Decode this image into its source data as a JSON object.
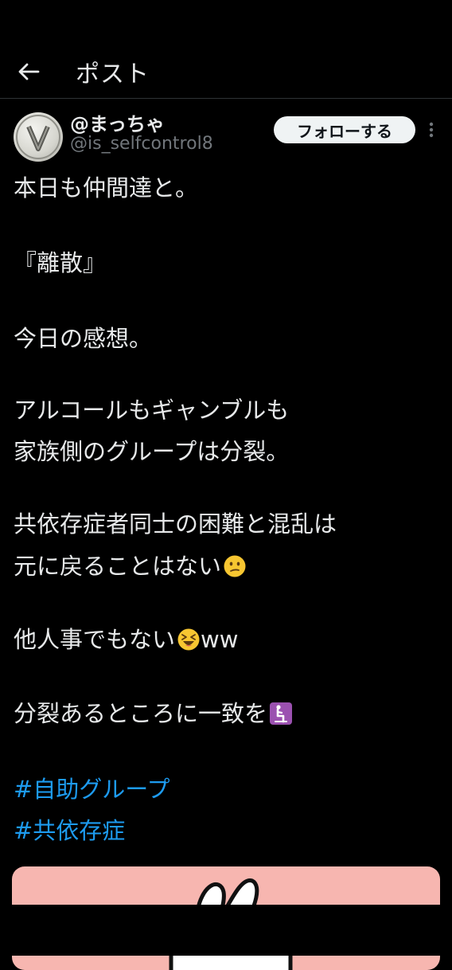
{
  "header": {
    "back_icon": "arrow-left-icon",
    "title": "ポスト"
  },
  "author": {
    "avatar_icon": "avatar-v-coin",
    "display_name": "@まっちゃ",
    "handle": "@is_selfcontrol8",
    "follow_label": "フォローする",
    "more_icon": "more-vertical-icon"
  },
  "post": {
    "lines": [
      "本日も仲間達と。",
      "『離散』",
      "今日の感想。",
      "アルコールもギャンブルも",
      "家族側のグループは分裂。",
      "共依存症者同士の困難と混乱は",
      "元に戻ることはない",
      "他人事でもない",
      "ww",
      "分裂あるところに一致を"
    ],
    "emojis": {
      "confused": "confused-face-emoji",
      "laughing": "grinning-squinting-face-emoji",
      "kneeling": "person-kneeling-emoji"
    },
    "hashtags": [
      "#自助グループ",
      "#共依存症"
    ]
  },
  "media": {
    "background": "#f7b6b0"
  },
  "colors": {
    "background": "#000000",
    "text": "#e7e9ea",
    "muted": "#71767b",
    "link": "#1d9bf0",
    "button_bg": "#eff3f4"
  }
}
